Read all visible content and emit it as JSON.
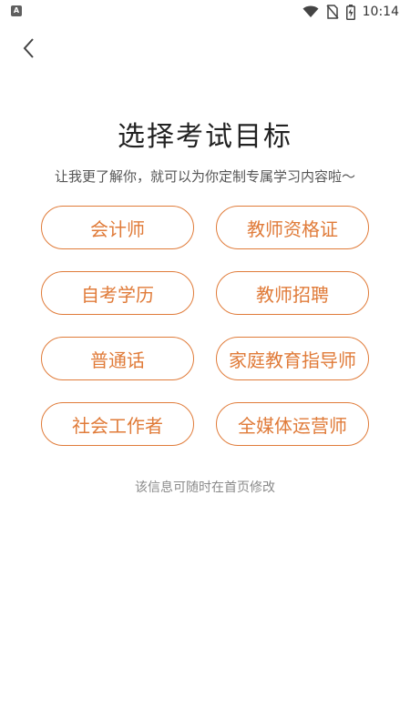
{
  "status_bar": {
    "time": "10:14",
    "app_icon_letter": "A",
    "icons": [
      "wifi-icon",
      "no-sim-icon",
      "battery-icon"
    ]
  },
  "header": {
    "back_icon": "chevron-left-icon"
  },
  "main": {
    "title": "选择考试目标",
    "subtitle": "让我更了解你，就可以为你定制专属学习内容啦～",
    "options": [
      {
        "label": "会计师"
      },
      {
        "label": "教师资格证"
      },
      {
        "label": "自考学历"
      },
      {
        "label": "教师招聘"
      },
      {
        "label": "普通话"
      },
      {
        "label": "家庭教育指导师"
      },
      {
        "label": "社会工作者"
      },
      {
        "label": "全媒体运营师"
      }
    ],
    "footer_note": "该信息可随时在首页修改"
  },
  "colors": {
    "accent": "#e07b39",
    "title": "#222222",
    "subtitle": "#555555",
    "note": "#8a8a8a"
  }
}
